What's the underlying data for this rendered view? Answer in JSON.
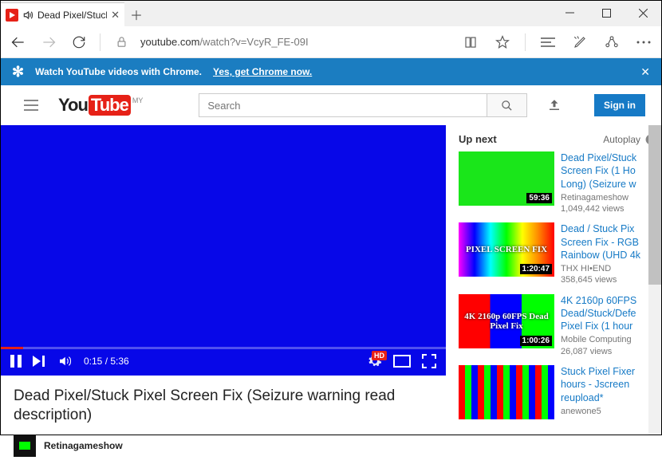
{
  "tab": {
    "title": "Dead Pixel/Stuck Pi"
  },
  "url": {
    "domain": "youtube.com",
    "path": "/watch?v=VcyR_FE-09I"
  },
  "banner": {
    "text": "Watch YouTube videos with Chrome.",
    "cta": "Yes, get Chrome now."
  },
  "yt": {
    "logo_left": "You",
    "logo_right": "Tube",
    "country": "MY",
    "search_placeholder": "Search",
    "signin": "Sign in"
  },
  "player": {
    "time": "0:15 / 5:36"
  },
  "video": {
    "title": "Dead Pixel/Stuck Pixel Screen Fix (Seizure warning read description)",
    "channel": "Retinagameshow"
  },
  "upnext": {
    "label": "Up next",
    "autoplay": "Autoplay"
  },
  "recs": [
    {
      "title": "Dead Pixel/Stuck Screen Fix (1 Ho Long) (Seizure w",
      "channel": "Retinagameshow",
      "views": "1,049,442 views",
      "dur": "59:36",
      "thumb": "green",
      "overlay": ""
    },
    {
      "title": "Dead / Stuck Pix Screen Fix - RGB Rainbow (UHD 4k",
      "channel": "THX  HI•END",
      "views": "358,645 views",
      "dur": "1:20:47",
      "thumb": "rainbow",
      "overlay": "PIXEL SCREEN FIX"
    },
    {
      "title": "4K 2160p 60FPS Dead/Stuck/Defe Pixel Fix (1 hour",
      "channel": "Mobile Computing",
      "views": "26,087 views",
      "dur": "1:00:26",
      "thumb": "rgb",
      "overlay": "4K 2160p 60FPS Dead Pixel Fix"
    },
    {
      "title": "Stuck Pixel Fixer hours - Jscreen reupload*",
      "channel": "anewone5",
      "views": "",
      "dur": "",
      "thumb": "pixels",
      "overlay": ""
    }
  ]
}
